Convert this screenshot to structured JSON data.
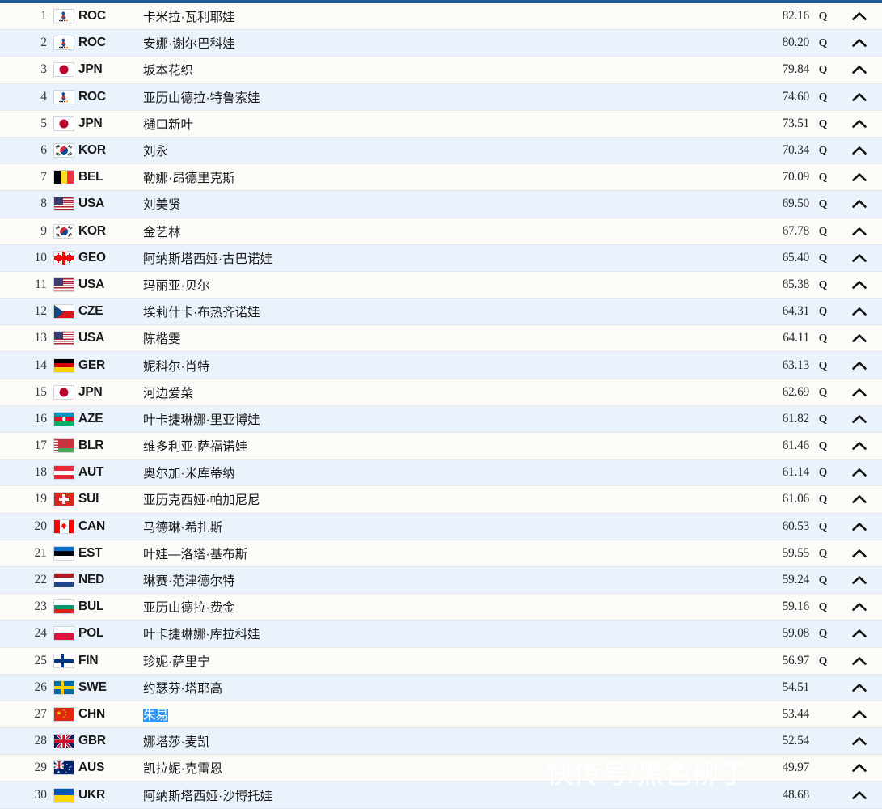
{
  "theme": {
    "topbar_color": "#1f5c99",
    "row_odd_bg": "#fdfbf8",
    "row_even_bg": "#eaf3fb",
    "selection_bg": "#3297fd",
    "divider": "#e3e9ef"
  },
  "icons": {
    "qualified": "Q",
    "expand": "chevron-up-icon"
  },
  "watermark": "快传号/黑色柳丁",
  "results": [
    {
      "rank": "1",
      "noc": "ROC",
      "flag": "ROC",
      "athlete": "卡米拉·瓦利耶娃",
      "score": "82.16",
      "q": "Q"
    },
    {
      "rank": "2",
      "noc": "ROC",
      "flag": "ROC",
      "athlete": "安娜·谢尔巴科娃",
      "score": "80.20",
      "q": "Q"
    },
    {
      "rank": "3",
      "noc": "JPN",
      "flag": "JPN",
      "athlete": "坂本花织",
      "score": "79.84",
      "q": "Q"
    },
    {
      "rank": "4",
      "noc": "ROC",
      "flag": "ROC",
      "athlete": "亚历山德拉·特鲁索娃",
      "score": "74.60",
      "q": "Q"
    },
    {
      "rank": "5",
      "noc": "JPN",
      "flag": "JPN",
      "athlete": "樋口新叶",
      "score": "73.51",
      "q": "Q"
    },
    {
      "rank": "6",
      "noc": "KOR",
      "flag": "KOR",
      "athlete": "刘永",
      "score": "70.34",
      "q": "Q"
    },
    {
      "rank": "7",
      "noc": "BEL",
      "flag": "BEL",
      "athlete": "勒娜·昂德里克斯",
      "score": "70.09",
      "q": "Q"
    },
    {
      "rank": "8",
      "noc": "USA",
      "flag": "USA",
      "athlete": "刘美贤",
      "score": "69.50",
      "q": "Q"
    },
    {
      "rank": "9",
      "noc": "KOR",
      "flag": "KOR",
      "athlete": "金艺林",
      "score": "67.78",
      "q": "Q"
    },
    {
      "rank": "10",
      "noc": "GEO",
      "flag": "GEO",
      "athlete": "阿纳斯塔西娅·古巴诺娃",
      "score": "65.40",
      "q": "Q"
    },
    {
      "rank": "11",
      "noc": "USA",
      "flag": "USA",
      "athlete": "玛丽亚·贝尔",
      "score": "65.38",
      "q": "Q"
    },
    {
      "rank": "12",
      "noc": "CZE",
      "flag": "CZE",
      "athlete": "埃莉什卡·布热齐诺娃",
      "score": "64.31",
      "q": "Q"
    },
    {
      "rank": "13",
      "noc": "USA",
      "flag": "USA",
      "athlete": "陈楷雯",
      "score": "64.11",
      "q": "Q"
    },
    {
      "rank": "14",
      "noc": "GER",
      "flag": "GER",
      "athlete": "妮科尔·肖特",
      "score": "63.13",
      "q": "Q"
    },
    {
      "rank": "15",
      "noc": "JPN",
      "flag": "JPN",
      "athlete": "河边爱菜",
      "score": "62.69",
      "q": "Q"
    },
    {
      "rank": "16",
      "noc": "AZE",
      "flag": "AZE",
      "athlete": "叶卡捷琳娜·里亚博娃",
      "score": "61.82",
      "q": "Q"
    },
    {
      "rank": "17",
      "noc": "BLR",
      "flag": "BLR",
      "athlete": "维多利亚·萨福诺娃",
      "score": "61.46",
      "q": "Q"
    },
    {
      "rank": "18",
      "noc": "AUT",
      "flag": "AUT",
      "athlete": "奥尔加·米库蒂纳",
      "score": "61.14",
      "q": "Q"
    },
    {
      "rank": "19",
      "noc": "SUI",
      "flag": "SUI",
      "athlete": "亚历克西娅·帕加尼尼",
      "score": "61.06",
      "q": "Q"
    },
    {
      "rank": "20",
      "noc": "CAN",
      "flag": "CAN",
      "athlete": "马德琳·希扎斯",
      "score": "60.53",
      "q": "Q"
    },
    {
      "rank": "21",
      "noc": "EST",
      "flag": "EST",
      "athlete": "叶娃—洛塔·基布斯",
      "score": "59.55",
      "q": "Q"
    },
    {
      "rank": "22",
      "noc": "NED",
      "flag": "NED",
      "athlete": "琳赛·范津德尔特",
      "score": "59.24",
      "q": "Q"
    },
    {
      "rank": "23",
      "noc": "BUL",
      "flag": "BUL",
      "athlete": "亚历山德拉·费金",
      "score": "59.16",
      "q": "Q"
    },
    {
      "rank": "24",
      "noc": "POL",
      "flag": "POL",
      "athlete": "叶卡捷琳娜·库拉科娃",
      "score": "59.08",
      "q": "Q"
    },
    {
      "rank": "25",
      "noc": "FIN",
      "flag": "FIN",
      "athlete": "珍妮·萨里宁",
      "score": "56.97",
      "q": "Q"
    },
    {
      "rank": "26",
      "noc": "SWE",
      "flag": "SWE",
      "athlete": "约瑟芬·塔耶高",
      "score": "54.51",
      "q": ""
    },
    {
      "rank": "27",
      "noc": "CHN",
      "flag": "CHN",
      "athlete": "朱易",
      "score": "53.44",
      "q": "",
      "selected": true
    },
    {
      "rank": "28",
      "noc": "GBR",
      "flag": "GBR",
      "athlete": "娜塔莎·麦凯",
      "score": "52.54",
      "q": ""
    },
    {
      "rank": "29",
      "noc": "AUS",
      "flag": "AUS",
      "athlete": "凯拉妮·克雷恩",
      "score": "49.97",
      "q": ""
    },
    {
      "rank": "30",
      "noc": "UKR",
      "flag": "UKR",
      "athlete": "阿纳斯塔西娅·沙博托娃",
      "score": "48.68",
      "q": ""
    }
  ]
}
